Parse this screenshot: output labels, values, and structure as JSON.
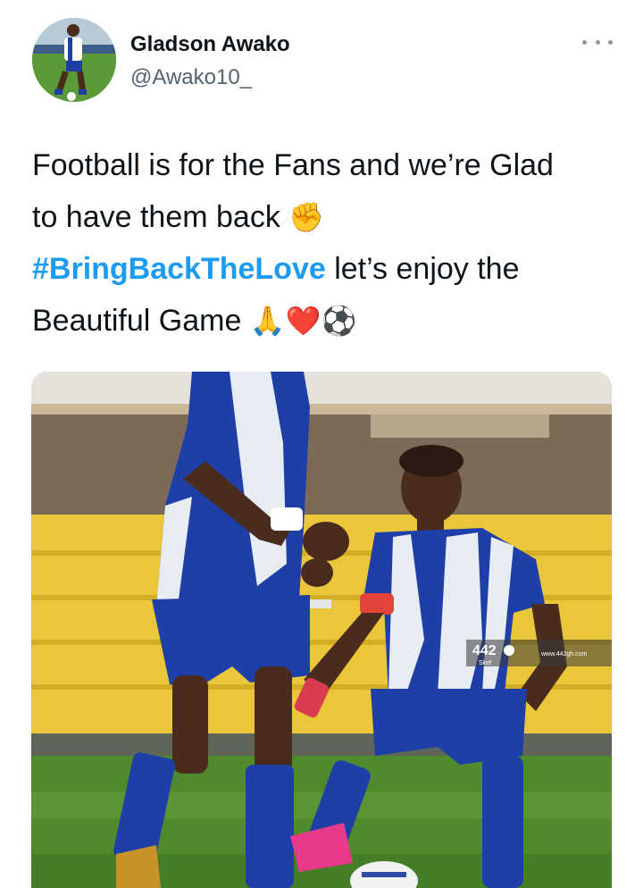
{
  "author": {
    "display_name": "Gladson Awako",
    "handle": "@Awako10_",
    "avatar_icon": "avatar-photo"
  },
  "tweet": {
    "line1": "Football is for the Fans and we’re Glad",
    "line2_text": "to have them back",
    "line2_emoji": "✊",
    "hashtag": "#BringBackTheLove",
    "line3_text": " let’s enjoy the",
    "line4_text": "Beautiful Game",
    "line4_emojis": [
      "🙏",
      "❤️",
      "⚽"
    ]
  },
  "media": {
    "watermark_brand": "442",
    "watermark_sub": "Skef",
    "watermark_url": "www.442gh.com",
    "colors": {
      "stands": "#e9c63a",
      "pitch": "#4f8a2c",
      "kit_blue": "#1f3fa8",
      "kit_white": "#e7ecf3"
    }
  },
  "more_icon": "more-horizontal-icon"
}
